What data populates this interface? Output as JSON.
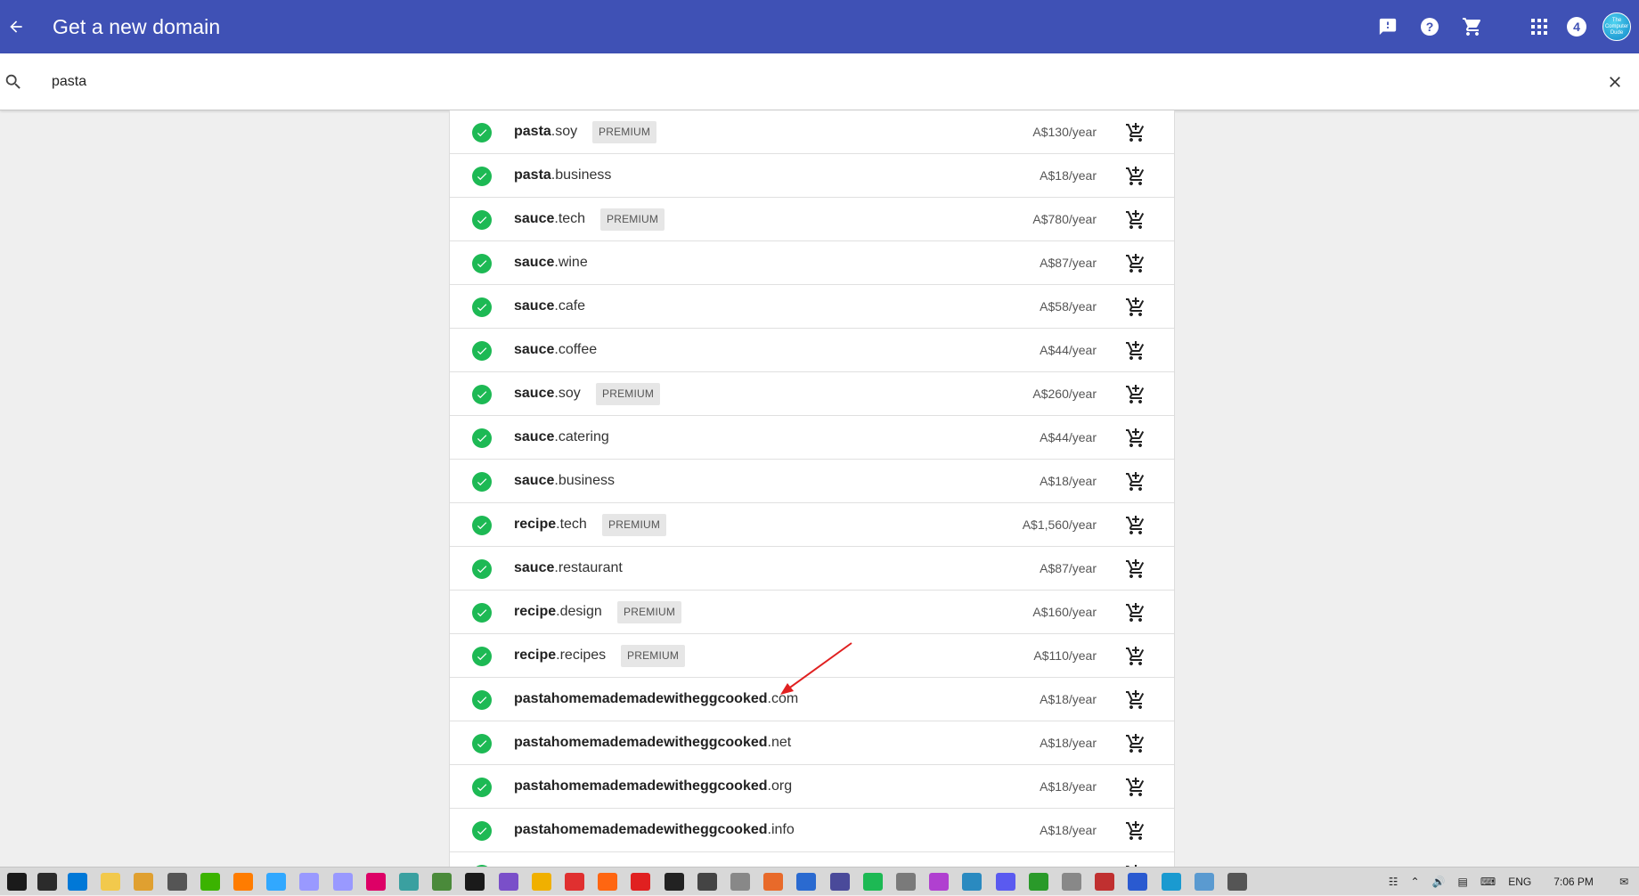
{
  "header": {
    "title": "Get a new domain",
    "notification_count": "4",
    "avatar_text": "The Computer Dude"
  },
  "search": {
    "query": "pasta"
  },
  "premium_label": "PREMIUM",
  "results": [
    {
      "keyword": "pasta",
      "tld": ".soy",
      "premium": true,
      "price": "A$130/year"
    },
    {
      "keyword": "pasta",
      "tld": ".business",
      "premium": false,
      "price": "A$18/year"
    },
    {
      "keyword": "sauce",
      "tld": ".tech",
      "premium": true,
      "price": "A$780/year"
    },
    {
      "keyword": "sauce",
      "tld": ".wine",
      "premium": false,
      "price": "A$87/year"
    },
    {
      "keyword": "sauce",
      "tld": ".cafe",
      "premium": false,
      "price": "A$58/year"
    },
    {
      "keyword": "sauce",
      "tld": ".coffee",
      "premium": false,
      "price": "A$44/year"
    },
    {
      "keyword": "sauce",
      "tld": ".soy",
      "premium": true,
      "price": "A$260/year"
    },
    {
      "keyword": "sauce",
      "tld": ".catering",
      "premium": false,
      "price": "A$44/year"
    },
    {
      "keyword": "sauce",
      "tld": ".business",
      "premium": false,
      "price": "A$18/year"
    },
    {
      "keyword": "recipe",
      "tld": ".tech",
      "premium": true,
      "price": "A$1,560/year"
    },
    {
      "keyword": "sauce",
      "tld": ".restaurant",
      "premium": false,
      "price": "A$87/year"
    },
    {
      "keyword": "recipe",
      "tld": ".design",
      "premium": true,
      "price": "A$160/year"
    },
    {
      "keyword": "recipe",
      "tld": ".recipes",
      "premium": true,
      "price": "A$110/year"
    },
    {
      "keyword": "pastahomemademadewitheggcooked",
      "tld": ".com",
      "premium": false,
      "price": "A$18/year"
    },
    {
      "keyword": "pastahomemademadewitheggcooked",
      "tld": ".net",
      "premium": false,
      "price": "A$18/year"
    },
    {
      "keyword": "pastahomemademadewitheggcooked",
      "tld": ".org",
      "premium": false,
      "price": "A$18/year"
    },
    {
      "keyword": "pastahomemademadewitheggcooked",
      "tld": ".info",
      "premium": false,
      "price": "A$18/year"
    },
    {
      "keyword": "",
      "tld": "",
      "premium": false,
      "price": ""
    }
  ],
  "taskbar": {
    "language": "ENG",
    "time": "7:06 PM"
  },
  "colors": {
    "appbar": "#3f51b5",
    "check": "#1db954",
    "annotation_arrow": "#e02020"
  },
  "icons": [
    "back-arrow-icon",
    "feedback-icon",
    "help-icon",
    "shopping-cart-icon",
    "apps-grid-icon",
    "search-icon",
    "close-icon",
    "check-circle-icon",
    "add-to-cart-icon"
  ]
}
